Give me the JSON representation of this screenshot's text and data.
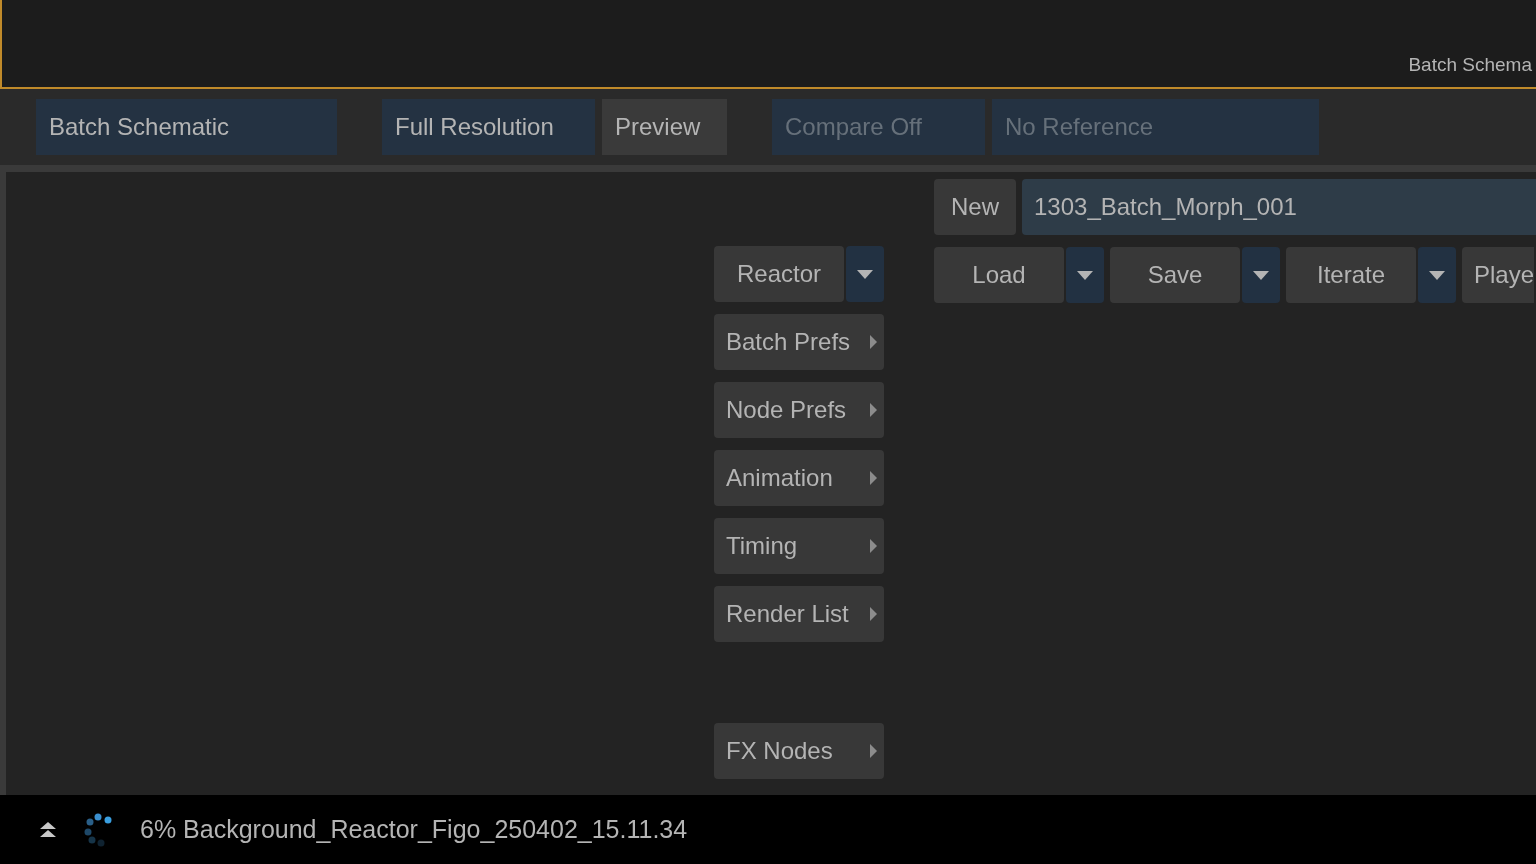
{
  "viewer": {
    "label": "Batch Schema"
  },
  "toolbar": [
    {
      "label": "Batch Schematic",
      "toggled": true,
      "disabled": false
    },
    {
      "label": "Full Resolution",
      "toggled": true,
      "disabled": false
    },
    {
      "label": "Preview",
      "toggled": false,
      "disabled": false
    },
    {
      "label": "Compare Off",
      "toggled": true,
      "disabled": true
    },
    {
      "label": "No Reference",
      "toggled": true,
      "disabled": true
    }
  ],
  "menu": [
    {
      "label": "Reactor",
      "kind": "dropdown"
    },
    {
      "label": "Batch Prefs",
      "kind": "submenu"
    },
    {
      "label": "Node Prefs",
      "kind": "submenu"
    },
    {
      "label": "Animation",
      "kind": "submenu"
    },
    {
      "label": "Timing",
      "kind": "submenu"
    },
    {
      "label": "Render List",
      "kind": "submenu"
    }
  ],
  "menu_bottom": [
    {
      "label": "FX Nodes",
      "kind": "submenu"
    }
  ],
  "setup": {
    "new_button": "New",
    "name": "1303_Batch_Morph_001",
    "actions": [
      {
        "label": "Load",
        "kind": "dropdown"
      },
      {
        "label": "Save",
        "kind": "dropdown"
      },
      {
        "label": "Iterate",
        "kind": "dropdown"
      },
      {
        "label": "Playe",
        "kind": "plain"
      }
    ]
  },
  "status": {
    "text": "6% Background_Reactor_Figo_250402_15.11.34"
  }
}
